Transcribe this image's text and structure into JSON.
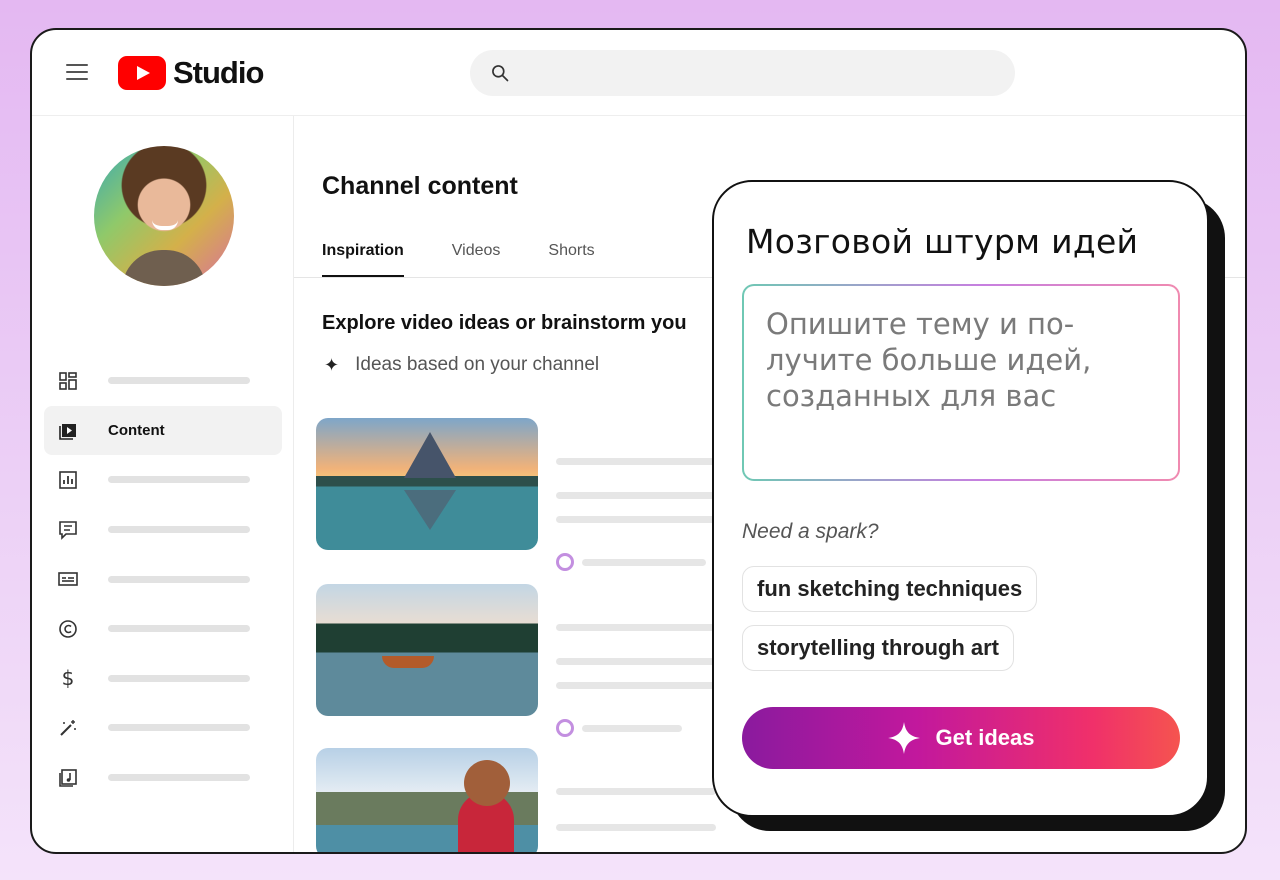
{
  "header": {
    "logo_text": "Studio",
    "search_placeholder": ""
  },
  "sidebar": {
    "items": [
      {
        "icon": "dashboard-icon",
        "label": ""
      },
      {
        "icon": "content-icon",
        "label": "Content",
        "active": true
      },
      {
        "icon": "analytics-icon",
        "label": ""
      },
      {
        "icon": "comments-icon",
        "label": ""
      },
      {
        "icon": "subtitles-icon",
        "label": ""
      },
      {
        "icon": "copyright-icon",
        "label": ""
      },
      {
        "icon": "earn-icon",
        "label": ""
      },
      {
        "icon": "customization-icon",
        "label": ""
      },
      {
        "icon": "audio-library-icon",
        "label": ""
      }
    ]
  },
  "main": {
    "title": "Channel content",
    "tabs": [
      {
        "label": "Inspiration",
        "active": true
      },
      {
        "label": "Videos"
      },
      {
        "label": "Shorts"
      }
    ],
    "explore_heading": "Explore video ideas or brainstorm you",
    "ideas_label": "Ideas based on your channel"
  },
  "brainstorm": {
    "title": "Мозговой штурм идей",
    "prompt_placeholder": "Опишите тему и по-\nлучите больше идей,\nсозданных для вас",
    "spark_label": "Need a spark?",
    "chips": [
      "fun sketching techniques",
      "storytelling through art"
    ],
    "cta_label": "Get ideas"
  },
  "colors": {
    "brand_red": "#ff0000",
    "cta_gradient_start": "#8a1a9e",
    "cta_gradient_end": "#f5544f",
    "background_lilac": "#e4b8f2"
  }
}
